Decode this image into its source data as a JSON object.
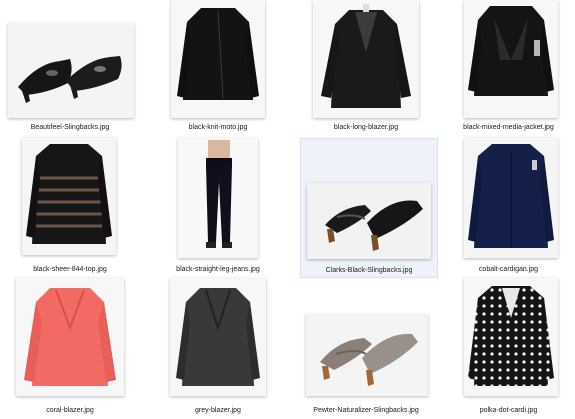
{
  "explorer": {
    "view": "large-icons",
    "selected_index": 6,
    "files": [
      {
        "name": "Beautifeel-Slingbacks.jpg",
        "icon": "black-slingback-shoes-thumbnail"
      },
      {
        "name": "black-knit-moto.jpg",
        "icon": "black-moto-jacket-thumbnail"
      },
      {
        "name": "black-long-blazer.jpg",
        "icon": "black-blazer-thumbnail"
      },
      {
        "name": "black-mixed-media-jacket.jpg",
        "icon": "black-leather-jacket-thumbnail"
      },
      {
        "name": "black-sheer-844-top.jpg",
        "icon": "black-sheer-top-thumbnail"
      },
      {
        "name": "black-straight-leg-jeans.jpg",
        "icon": "black-jeans-thumbnail"
      },
      {
        "name": "Clarks-Black-Slingbacks.jpg",
        "icon": "black-sandals-thumbnail"
      },
      {
        "name": "cobalt-cardigan.jpg",
        "icon": "navy-cardigan-thumbnail"
      },
      {
        "name": "coral-blazer.jpg",
        "icon": "coral-blazer-thumbnail"
      },
      {
        "name": "grey-blazer.jpg",
        "icon": "grey-blazer-thumbnail"
      },
      {
        "name": "Pewter-Naturalizer-Slingbacks.jpg",
        "icon": "pewter-sandals-thumbnail"
      },
      {
        "name": "polka-dot-cardi.jpg",
        "icon": "polka-dot-cardigan-thumbnail"
      }
    ]
  },
  "colors": {
    "selection": "#eef3fa",
    "black_garment": "#141414",
    "navy": "#14204a",
    "coral": "#f26a63",
    "grey": "#3a3838",
    "pewter": "#8a8079"
  }
}
